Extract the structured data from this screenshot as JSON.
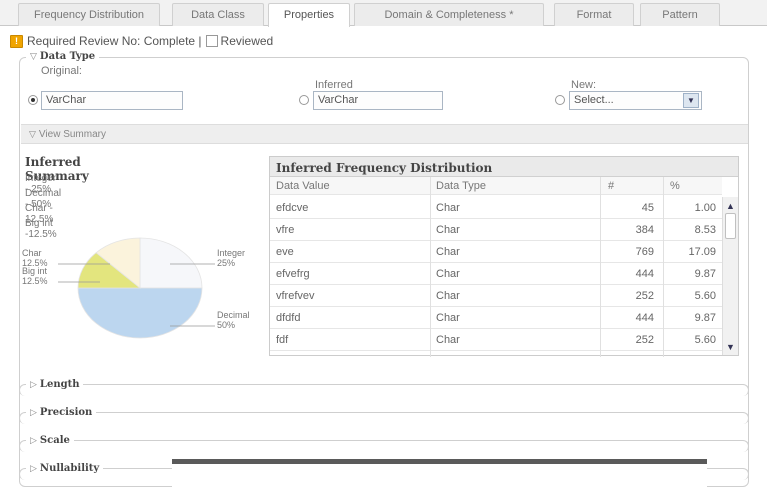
{
  "tabs": [
    {
      "label": "Frequency Distribution",
      "active": false
    },
    {
      "label": "Data Class",
      "active": false
    },
    {
      "label": "Properties",
      "active": true
    },
    {
      "label": "Domain & Completeness *",
      "active": false
    },
    {
      "label": "Format",
      "active": false
    },
    {
      "label": "Pattern",
      "active": false
    }
  ],
  "review": {
    "status_text": "Required Review No: Complete |",
    "reviewed_label": "Reviewed",
    "warning_glyph": "!"
  },
  "data_type": {
    "title": "Data Type",
    "original": {
      "label": "Original:",
      "value": "VarChar",
      "selected": true
    },
    "inferred": {
      "label": "Inferred",
      "value": "VarChar",
      "selected": false
    },
    "new": {
      "label": "New:",
      "value": "Select...",
      "selected": false
    }
  },
  "view_summary": {
    "label": "View Summary"
  },
  "inferred_summary": {
    "title": "Inferred Summary",
    "lines": [
      "Integer - 25%",
      "Decimal - 50%",
      "Char - 12.5%",
      "Big int -12.5%"
    ]
  },
  "chart_data": {
    "type": "pie",
    "slices": [
      {
        "name": "Integer",
        "percent": 25,
        "label": "Integer",
        "pct_label": "25%",
        "color": "#f6f7fa"
      },
      {
        "name": "Decimal",
        "percent": 50,
        "label": "Decimal",
        "pct_label": "50%",
        "color": "#bcd6ef"
      },
      {
        "name": "Char",
        "percent": 12.5,
        "label": "Char",
        "pct_label": "12.5%",
        "color": "#fbf3dc"
      },
      {
        "name": "Big int",
        "percent": 12.5,
        "label": "Big int",
        "pct_label": "12.5%",
        "color": "#e3e57e"
      }
    ]
  },
  "freq": {
    "title": "Inferred Frequency Distribution",
    "columns": [
      "Data Value",
      "Data Type",
      "#",
      "%"
    ],
    "rows": [
      [
        "efdcve",
        "Char",
        "45",
        "1.00"
      ],
      [
        "vfre",
        "Char",
        "384",
        "8.53"
      ],
      [
        "eve",
        "Char",
        "769",
        "17.09"
      ],
      [
        "efvefrg",
        "Char",
        "444",
        "9.87"
      ],
      [
        "vfrefvev",
        "Char",
        "252",
        "5.60"
      ],
      [
        "dfdfd",
        "Char",
        "444",
        "9.87"
      ],
      [
        "fdf",
        "Char",
        "252",
        "5.60"
      ]
    ]
  },
  "collapsed_sections": [
    "Length",
    "Precision",
    "Scale",
    "Nullability"
  ],
  "icons": {
    "chevron_down": "▽",
    "chevron_right": "▷",
    "select_arrow": "▼",
    "scroll_up": "▲",
    "scroll_down": "▼"
  }
}
